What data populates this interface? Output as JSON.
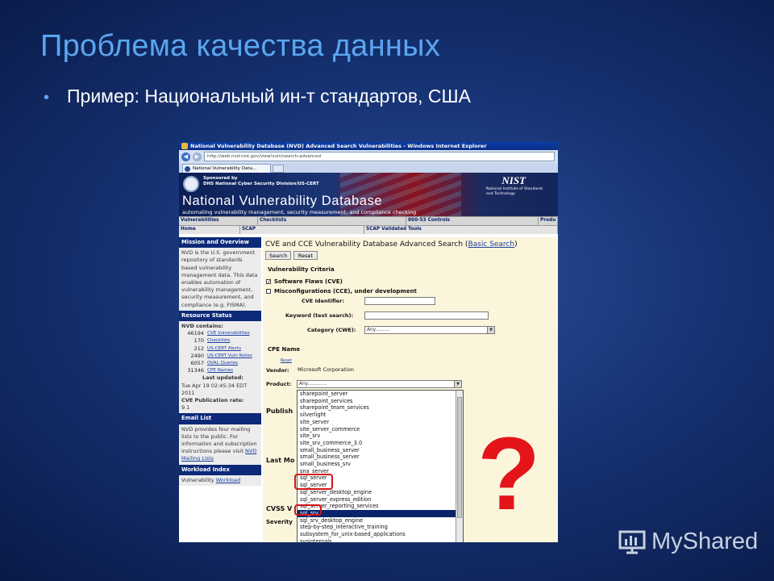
{
  "slide": {
    "title": "Проблема качества данных",
    "bullet": "Пример: Национальный ин-т стандартов, США",
    "question_mark": "?",
    "watermark": "MyShared",
    "accent_color": "#5aa6f0",
    "question_color": "#e3151b"
  },
  "browser": {
    "window_title": "National Vulnerability Database (NVD) Advanced Search Vulnerabilities - Windows Internet Explorer",
    "url": "http://web.nvd.nist.gov/view/vuln/search-advanced",
    "tab_label": "National Vulnerability Data..."
  },
  "nvd": {
    "sponsor_line1": "Sponsored by",
    "sponsor_line2": "DHS National Cyber Security Division/US-CERT",
    "nist_logo": "NIST",
    "nist_sub": "National Institute of Standards and Technology",
    "name": "National Vulnerability Database",
    "tagline": "automating vulnerability management, security measurement, and compliance checking",
    "nav_top": [
      "Vulnerabilities",
      "Checklists",
      "800-53 Controls",
      "Produ"
    ],
    "nav_bottom": [
      "Home",
      "SCAP",
      "SCAP Validated Tools"
    ]
  },
  "sidebar": {
    "mission_header": "Mission and Overview",
    "mission_text": "NVD is the U.S. government repository of standards based vulnerability management data. This data enables automation of vulnerability management, security measurement, and compliance (e.g. FISMA).",
    "resource_header": "Resource Status",
    "contains_label": "NVD contains:",
    "stats": [
      {
        "n": "46194",
        "label": "CVE Vulnerabilities"
      },
      {
        "n": "170",
        "label": "Checklists"
      },
      {
        "n": "212",
        "label": "US-CERT Alerts"
      },
      {
        "n": "2490",
        "label": "US-CERT Vuln Notes"
      },
      {
        "n": "6057",
        "label": "OVAL Queries"
      },
      {
        "n": "31346",
        "label": "CPE Names"
      }
    ],
    "last_updated_label": "Last updated:",
    "last_updated": "Tue Apr 19 02:45:34 EDT 2011",
    "pub_rate_label": "CVE Publication rate:",
    "pub_rate": "9.1",
    "email_header": "Email List",
    "email_text": "NVD provides four mailing lists to the public. For information and subscription instructions please visit",
    "email_link": "NVD Mailing Lists",
    "workload_header": "Workload Index",
    "workload_text": "Vulnerability",
    "workload_link": "Workload"
  },
  "search": {
    "title": "CVE and CCE Vulnerability Database Advanced Search (",
    "basic_link": "Basic Search",
    "title_end": ")",
    "search_btn": "Search",
    "reset_btn": "Reset",
    "criteria_label": "Vulnerability Criteria",
    "software_flaws": "Software Flaws (CVE)",
    "software_checked": "✓",
    "misconfig": "Misconfigurations (CCE), under development",
    "cve_id_label": "CVE Identifier:",
    "keyword_label": "Keyword (text search):",
    "category_label": "Category (CWE):",
    "category_value": "Any..........",
    "cpe_label": "CPE Name",
    "vendor_reset": "Reset",
    "vendor_label": "Vendor:",
    "vendor_value": "Microsoft Corporation",
    "product_label": "Product:",
    "product_value": "Any.............",
    "published_partial": "Publish",
    "last_mod_partial": "Last Mo",
    "cvss_partial": "CVSS V",
    "severity_partial": "Severity",
    "product_options": [
      "sharepoint_server",
      "sharepoint_services",
      "sharepoint_team_services",
      "silverlight",
      "site_server",
      "site_server_commerce",
      "site_srv",
      "site_srv_commerce_3.0",
      "small_business_server",
      "small_business_server",
      "small_business_srv",
      "sna_server",
      "sql_server",
      "sql_server",
      "sql_server_desktop_engine",
      "sql_server_express_edition",
      "sql_server_reporting_services",
      "sql_srv",
      "sql_srv_desktop_engine",
      "step-by-step_interactive_training",
      "subsystem_for_unix-based_applications",
      "sysinternals"
    ],
    "selected_option_index": 17
  }
}
